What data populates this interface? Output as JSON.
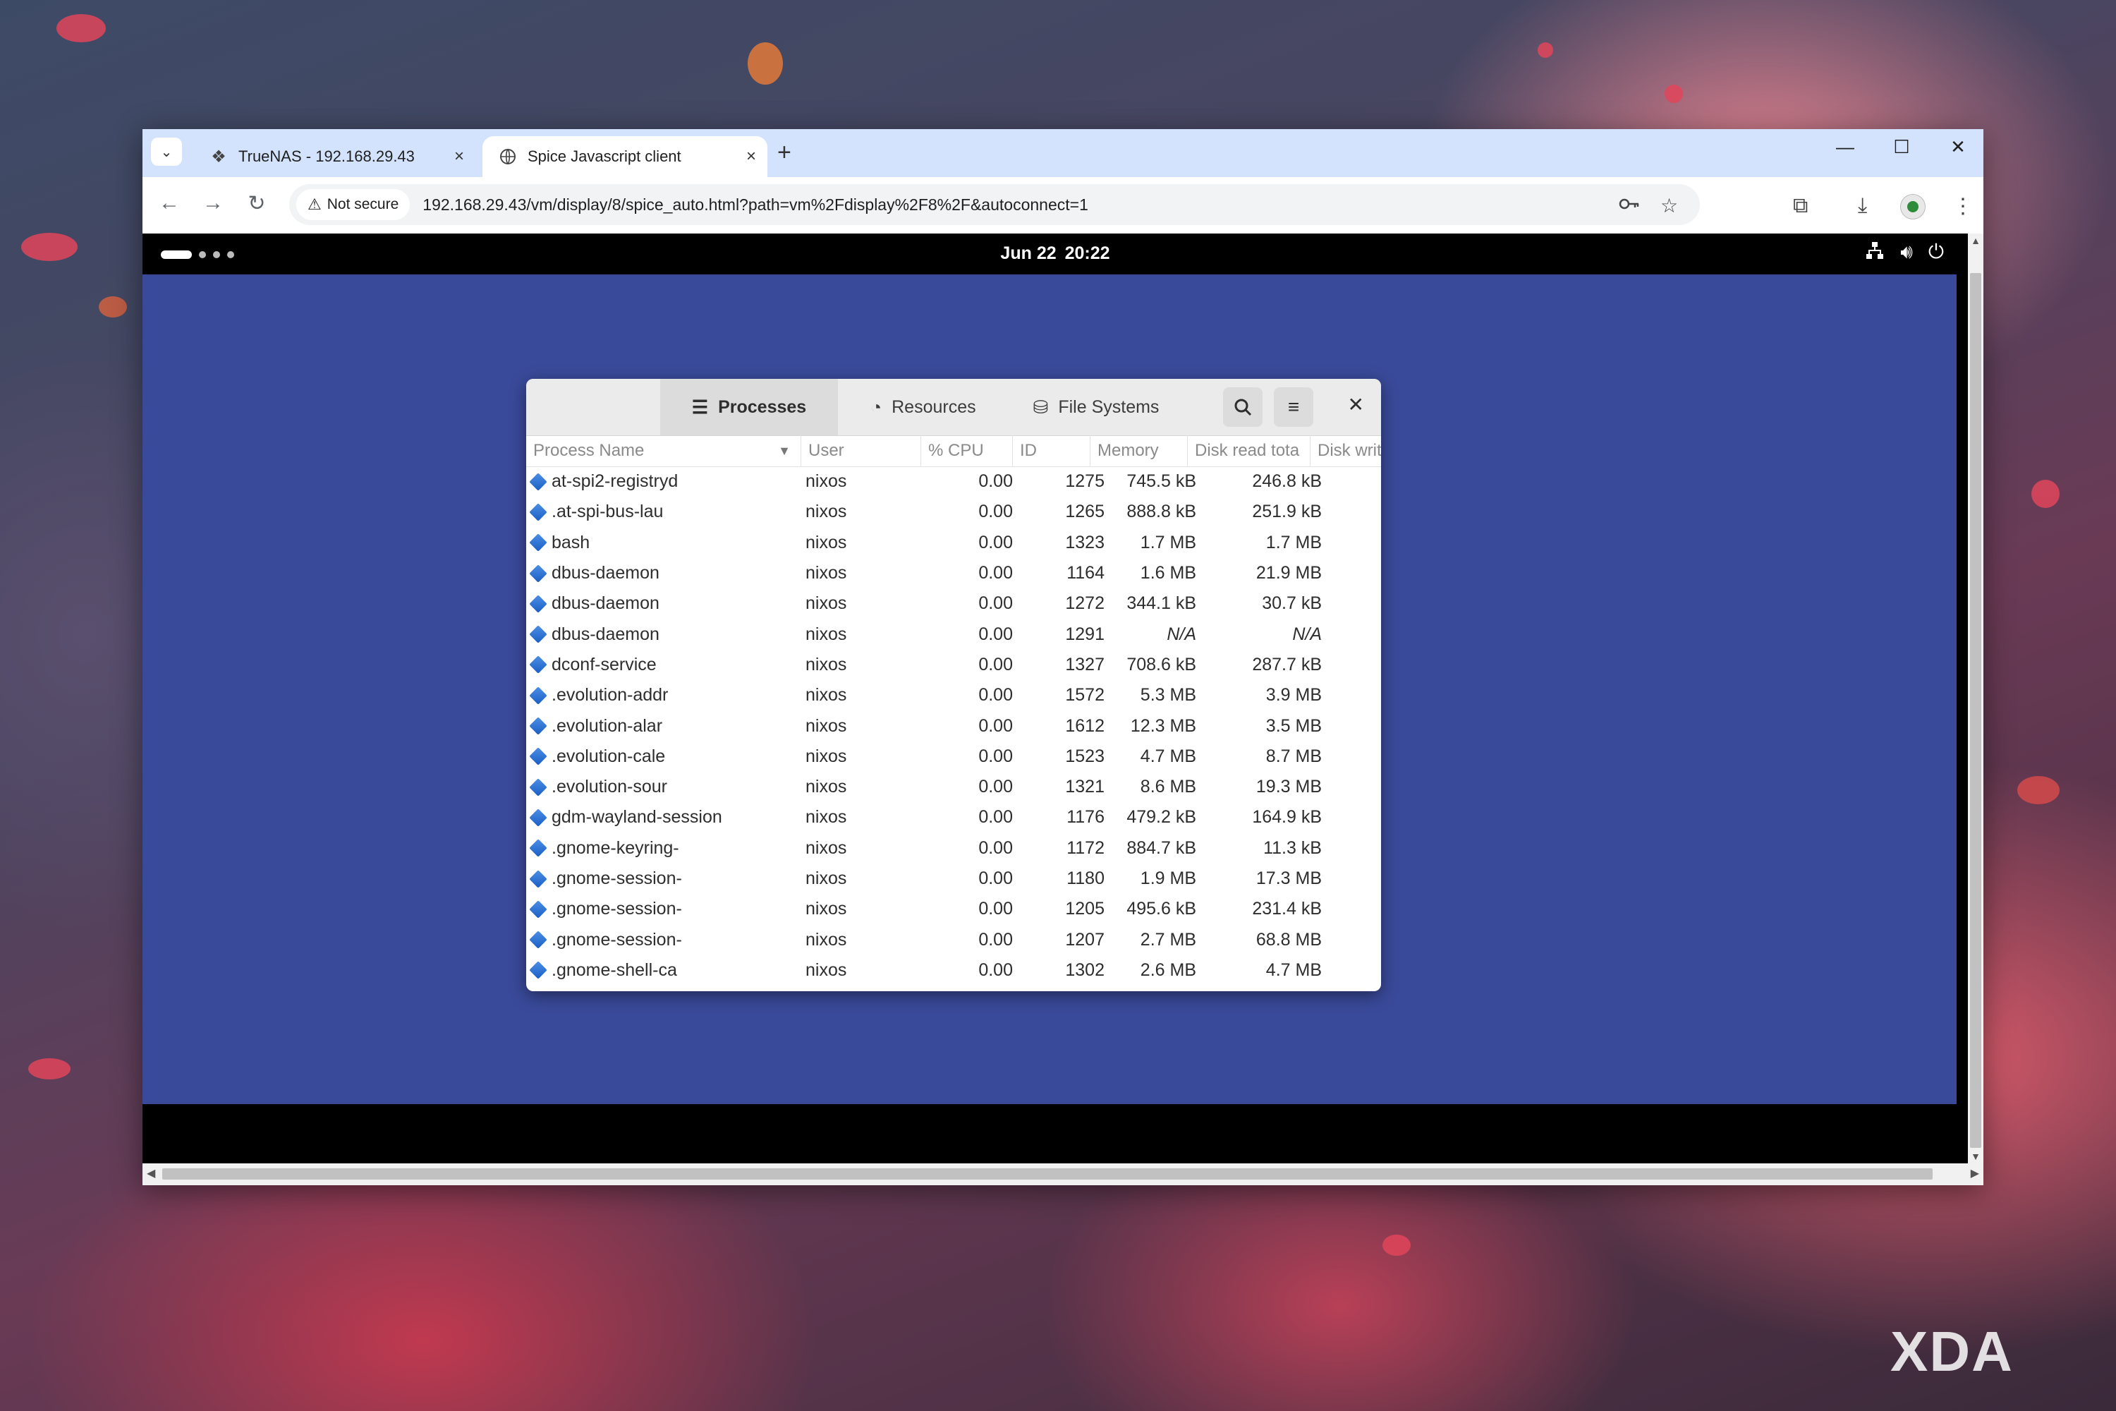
{
  "browser": {
    "tabs": [
      {
        "title": "TrueNAS - 192.168.29.43",
        "active": false
      },
      {
        "title": "Spice Javascript client",
        "active": true
      }
    ],
    "new_tab_label": "+",
    "window_controls": {
      "minimize": "—",
      "maximize": "☐",
      "close": "✕"
    },
    "security_label": "Not secure",
    "url": "192.168.29.43/vm/display/8/spice_auto.html?path=vm%2Fdisplay%2F8%2F&autoconnect=1"
  },
  "gnome": {
    "date": "Jun 22",
    "time": "20:22"
  },
  "system_monitor": {
    "tabs": [
      {
        "label": "Processes",
        "icon": "list-icon",
        "active": true
      },
      {
        "label": "Resources",
        "icon": "gauge-icon",
        "active": false
      },
      {
        "label": "File Systems",
        "icon": "disk-icon",
        "active": false
      }
    ],
    "columns": [
      "Process Name",
      "User",
      "% CPU",
      "ID",
      "Memory",
      "Disk read tota",
      "Disk writ"
    ],
    "processes": [
      {
        "name": "at-spi2-registryd",
        "user": "nixos",
        "cpu": "0.00",
        "id": "1275",
        "memory": "745.5 kB",
        "disk_read": "246.8 kB"
      },
      {
        "name": ".at-spi-bus-lau",
        "user": "nixos",
        "cpu": "0.00",
        "id": "1265",
        "memory": "888.8 kB",
        "disk_read": "251.9 kB"
      },
      {
        "name": "bash",
        "user": "nixos",
        "cpu": "0.00",
        "id": "1323",
        "memory": "1.7 MB",
        "disk_read": "1.7 MB"
      },
      {
        "name": "dbus-daemon",
        "user": "nixos",
        "cpu": "0.00",
        "id": "1164",
        "memory": "1.6 MB",
        "disk_read": "21.9 MB"
      },
      {
        "name": "dbus-daemon",
        "user": "nixos",
        "cpu": "0.00",
        "id": "1272",
        "memory": "344.1 kB",
        "disk_read": "30.7 kB"
      },
      {
        "name": "dbus-daemon",
        "user": "nixos",
        "cpu": "0.00",
        "id": "1291",
        "memory": "N/A",
        "disk_read": "N/A"
      },
      {
        "name": "dconf-service",
        "user": "nixos",
        "cpu": "0.00",
        "id": "1327",
        "memory": "708.6 kB",
        "disk_read": "287.7 kB"
      },
      {
        "name": ".evolution-addr",
        "user": "nixos",
        "cpu": "0.00",
        "id": "1572",
        "memory": "5.3 MB",
        "disk_read": "3.9 MB"
      },
      {
        "name": ".evolution-alar",
        "user": "nixos",
        "cpu": "0.00",
        "id": "1612",
        "memory": "12.3 MB",
        "disk_read": "3.5 MB"
      },
      {
        "name": ".evolution-cale",
        "user": "nixos",
        "cpu": "0.00",
        "id": "1523",
        "memory": "4.7 MB",
        "disk_read": "8.7 MB"
      },
      {
        "name": ".evolution-sour",
        "user": "nixos",
        "cpu": "0.00",
        "id": "1321",
        "memory": "8.6 MB",
        "disk_read": "19.3 MB"
      },
      {
        "name": "gdm-wayland-session",
        "user": "nixos",
        "cpu": "0.00",
        "id": "1176",
        "memory": "479.2 kB",
        "disk_read": "164.9 kB"
      },
      {
        "name": ".gnome-keyring-",
        "user": "nixos",
        "cpu": "0.00",
        "id": "1172",
        "memory": "884.7 kB",
        "disk_read": "11.3 kB"
      },
      {
        "name": ".gnome-session-",
        "user": "nixos",
        "cpu": "0.00",
        "id": "1180",
        "memory": "1.9 MB",
        "disk_read": "17.3 MB"
      },
      {
        "name": ".gnome-session-",
        "user": "nixos",
        "cpu": "0.00",
        "id": "1205",
        "memory": "495.6 kB",
        "disk_read": "231.4 kB"
      },
      {
        "name": ".gnome-session-",
        "user": "nixos",
        "cpu": "0.00",
        "id": "1207",
        "memory": "2.7 MB",
        "disk_read": "68.8 MB"
      },
      {
        "name": ".gnome-shell-ca",
        "user": "nixos",
        "cpu": "0.00",
        "id": "1302",
        "memory": "2.6 MB",
        "disk_read": "4.7 MB"
      }
    ]
  },
  "watermark": "XDA",
  "colors": {
    "tabstrip": "#d3e3fd",
    "desktop": "#3a4a9a",
    "process_icon": "#2f6fd6"
  }
}
